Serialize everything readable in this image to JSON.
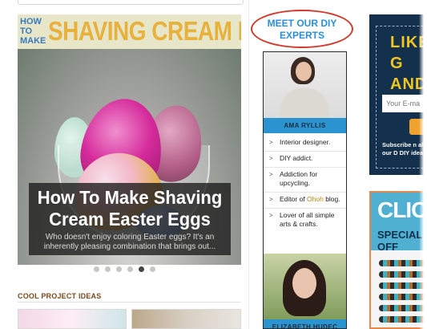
{
  "hero": {
    "banner_how_to": "HOW TO MAKE",
    "banner_title": "SHAVING CREAM EGGS",
    "headline": "How To Make Shaving Cream Easter Eggs",
    "excerpt": "Who doesn't enjoy coloring Easter eggs? It's an inherently pleasing combination that brings out...",
    "slides": 6,
    "active_slide": 5
  },
  "cool_projects": {
    "label": "COOL PROJECT IDEAS"
  },
  "experts": {
    "callout": "MEET OUR DIY EXPERTS",
    "expert1": {
      "name": "AMA RYLLIS",
      "bio": [
        {
          "text": "Interior designer."
        },
        {
          "text": "DIY addict."
        },
        {
          "text": "Addiction for upcycling."
        },
        {
          "pre": "Editor of ",
          "link": "Ohoh",
          "post": " blog."
        },
        {
          "text": "Lover of all simple arts & crafts."
        }
      ]
    },
    "expert2": {
      "name": "ELIZABETH HUDEC"
    }
  },
  "newsletter": {
    "heading": "LIKE G AND A",
    "email_placeholder": "Your E-ma",
    "subscribe_text": "Subscribe n about our D DIY ideas"
  },
  "ad": {
    "click": "CLICK",
    "offer": "SPECIAL OFF"
  },
  "colors": {
    "expert_bar": "#2b93cf",
    "callout_ring": "#d23a2c",
    "banner_title": "#e7b13c",
    "newsletter_bg": "#13304c",
    "newsletter_heading": "#f1c51e"
  }
}
